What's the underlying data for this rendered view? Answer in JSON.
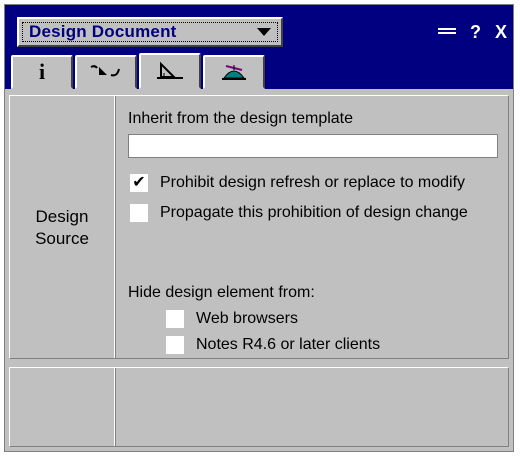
{
  "window": {
    "title": "Design Document",
    "buttons": [
      "menu",
      "?",
      "X"
    ]
  },
  "tabs": [
    {
      "icon": "info-icon",
      "glyph": "i"
    },
    {
      "icon": "field-properties-icon"
    },
    {
      "icon": "design-ruler-icon"
    },
    {
      "icon": "propeller-hat-icon"
    }
  ],
  "design_source": {
    "section_label_line1": "Design",
    "section_label_line2": "Source",
    "inherit_label": "Inherit from the design template",
    "inherit_value": "",
    "prohibit_label": "Prohibit design refresh or replace to modify",
    "prohibit_checked": true,
    "propagate_label": "Propagate this prohibition of design change",
    "propagate_checked": false,
    "hide_label": "Hide design element from:",
    "web_label": "Web browsers",
    "web_checked": false,
    "notes_label": "Notes R4.6 or later clients",
    "notes_checked": false,
    "checkmark": "✔"
  },
  "colors": {
    "titlebar": "#000080",
    "face": "#c0c0c0"
  }
}
